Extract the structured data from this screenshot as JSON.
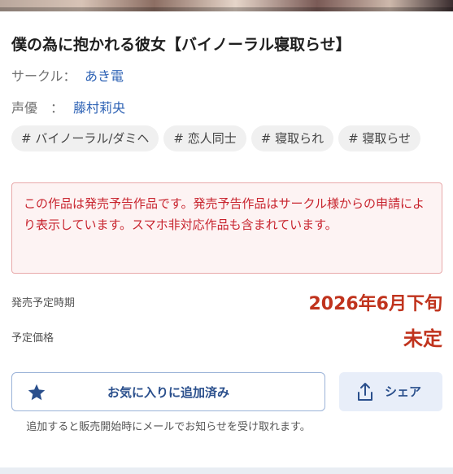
{
  "work": {
    "title": "僕の為に抱かれる彼女【バイノーラル寝取らせ】",
    "circle_label": "サークル：",
    "circle_name": "あき電",
    "voice_actor_label": "声優　：",
    "voice_actor_name": "藤村莉央",
    "tags": [
      "# バイノーラル/ダミヘ",
      "# 恋人同士",
      "# 寝取られ",
      "# 寝取らせ"
    ]
  },
  "notice": {
    "text": "この作品は発売予告作品です。発売予告作品はサークル様からの申請により表示しています。スマホ非対応作品も含まれています。"
  },
  "release": {
    "label": "発売予定時期",
    "value": "2026年6月下旬"
  },
  "price": {
    "label": "予定価格",
    "value": "未定"
  },
  "actions": {
    "favorite_label": "お気に入りに追加済み",
    "share_label": "シェア",
    "helper_text": "追加すると販売開始時にメールでお知らせを受け取れます。"
  },
  "colors": {
    "accent_link": "#2f63b5",
    "price_red": "#c0331d",
    "notice_red": "#c8242e",
    "button_navy": "#2a4f8c"
  },
  "icons": {
    "favorite": "star-icon",
    "share": "share-icon"
  }
}
